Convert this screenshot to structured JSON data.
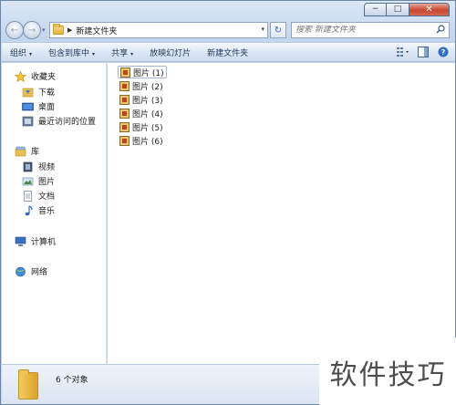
{
  "window": {
    "caption": {
      "minimize": "−",
      "maximize": "□",
      "close": "✕"
    }
  },
  "nav": {
    "back_glyph": "←",
    "forward_glyph": "→",
    "dropdown_glyph": "▾",
    "address": {
      "path": "新建文件夹",
      "separator": "▶",
      "dropdown": "▾"
    },
    "refresh_glyph": "↻",
    "search": {
      "placeholder": "搜索 新建文件夹"
    }
  },
  "toolbar": {
    "items": [
      {
        "label": "组织",
        "has_caret": true
      },
      {
        "label": "包含到库中",
        "has_caret": true
      },
      {
        "label": "共享",
        "has_caret": true
      },
      {
        "label": "放映幻灯片",
        "has_caret": false
      },
      {
        "label": "新建文件夹",
        "has_caret": false
      }
    ],
    "caret": "▾",
    "right_icons": [
      "view-options-icon",
      "preview-pane-icon",
      "help-icon"
    ],
    "help_glyph": "?"
  },
  "sidebar": {
    "favorites": {
      "label": "收藏夹",
      "items": [
        "下载",
        "桌面",
        "最近访问的位置"
      ]
    },
    "libraries": {
      "label": "库",
      "items": [
        "视频",
        "图片",
        "文档",
        "音乐"
      ]
    },
    "computer": {
      "label": "计算机"
    },
    "network": {
      "label": "网络"
    }
  },
  "files": [
    {
      "name": "图片 (1)",
      "selected": true
    },
    {
      "name": "图片 (2)",
      "selected": false
    },
    {
      "name": "图片 (3)",
      "selected": false
    },
    {
      "name": "图片 (4)",
      "selected": false
    },
    {
      "name": "图片 (5)",
      "selected": false
    },
    {
      "name": "图片 (6)",
      "selected": false
    }
  ],
  "details": {
    "count": "6 个对象"
  },
  "watermark": {
    "text": "软件技巧"
  },
  "colors": {
    "accent": "#2a6bd0",
    "window_frame": "#c4d6ee",
    "close_button": "#c7452f"
  }
}
